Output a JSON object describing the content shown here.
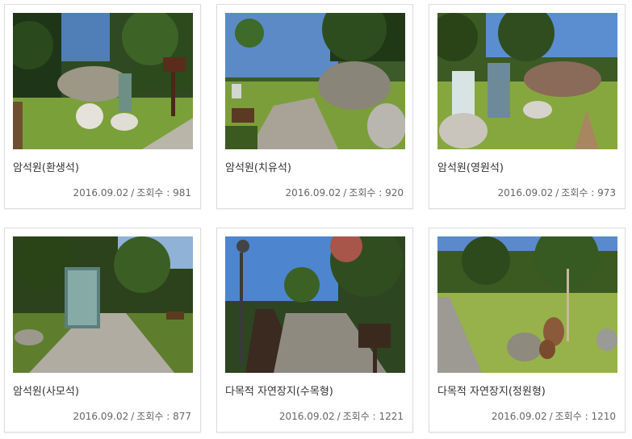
{
  "gallery": {
    "items": [
      {
        "title": "암석원(환생석)",
        "date": "2016.09.02",
        "views_label": "조회수 :",
        "views": "981"
      },
      {
        "title": "암석원(치유석)",
        "date": "2016.09.02",
        "views_label": "조회수 :",
        "views": "920"
      },
      {
        "title": "암석원(영원석)",
        "date": "2016.09.02",
        "views_label": "조회수 :",
        "views": "973"
      },
      {
        "title": "암석원(사모석)",
        "date": "2016.09.02",
        "views_label": "조회수 :",
        "views": "877"
      },
      {
        "title": "다목적 자연장지(수목형)",
        "date": "2016.09.02",
        "views_label": "조회수 :",
        "views": "1221"
      },
      {
        "title": "다목적 자연장지(정원형)",
        "date": "2016.09.02",
        "views_label": "조회수 :",
        "views": "1210"
      }
    ]
  }
}
